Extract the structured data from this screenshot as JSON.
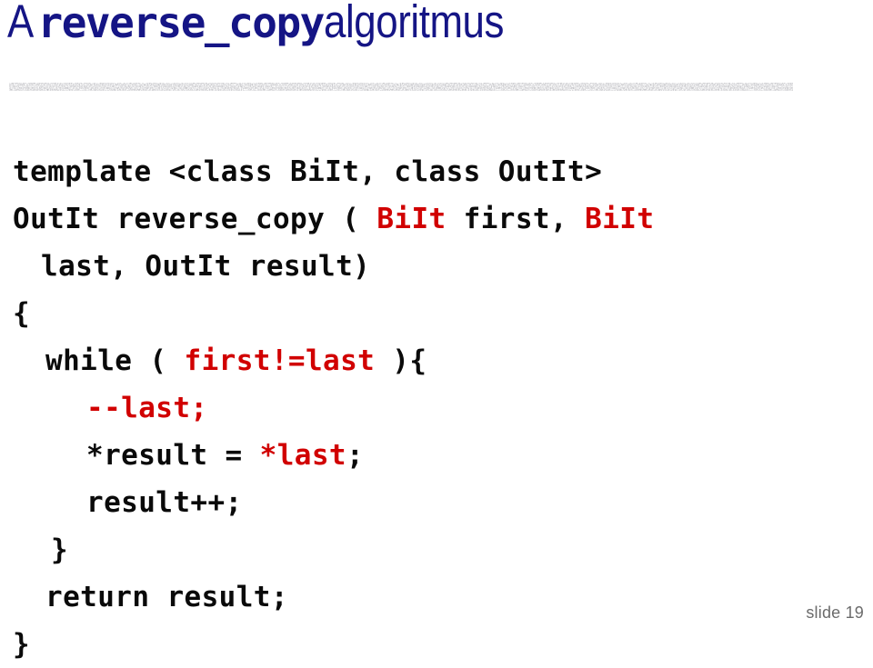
{
  "slide": {
    "title": {
      "prefix": "A ",
      "code_term": "reverse_copy",
      "suffix": " algoritmus",
      "color": "#151585"
    },
    "divider": {
      "name": "textured-rule",
      "color": "#8a8a8a"
    },
    "code": {
      "accent_color": "#d10000",
      "text_color": "#0a0a0a",
      "lines": [
        {
          "indent": "ind0",
          "segments": [
            {
              "text": "template <class BiIt, class OutIt>",
              "style": "kw"
            }
          ]
        },
        {
          "indent": "ind0",
          "segments": [
            {
              "text": "OutIt reverse_copy ( ",
              "style": "kw"
            },
            {
              "text": "BiIt",
              "style": "hl"
            },
            {
              "text": " first, ",
              "style": "kw"
            },
            {
              "text": "BiIt",
              "style": "hl"
            }
          ]
        },
        {
          "indent": "ind1b",
          "segments": [
            {
              "text": "last, OutIt result)",
              "style": "kw"
            }
          ]
        },
        {
          "indent": "ind-b",
          "segments": [
            {
              "text": "{",
              "style": "kw"
            }
          ]
        },
        {
          "indent": "ind1",
          "segments": [
            {
              "text": "while ( ",
              "style": "kw"
            },
            {
              "text": "first!=last",
              "style": "hl"
            },
            {
              "text": " ){",
              "style": "kw"
            }
          ]
        },
        {
          "indent": "ind2",
          "segments": [
            {
              "text": "--last;",
              "style": "hl"
            }
          ]
        },
        {
          "indent": "ind2",
          "segments": [
            {
              "text": "*result = ",
              "style": "kw"
            },
            {
              "text": "*last",
              "style": "hl"
            },
            {
              "text": ";",
              "style": "kw"
            }
          ]
        },
        {
          "indent": "ind2",
          "segments": [
            {
              "text": "result++;",
              "style": "kw"
            }
          ]
        },
        {
          "indent": "ind-cb",
          "segments": [
            {
              "text": "}",
              "style": "kw"
            }
          ]
        },
        {
          "indent": "ind1",
          "segments": [
            {
              "text": "return result;",
              "style": "kw"
            }
          ]
        },
        {
          "indent": "ind-b",
          "segments": [
            {
              "text": "}",
              "style": "kw"
            }
          ]
        }
      ]
    },
    "footer": {
      "slide_label": "slide 19"
    }
  }
}
